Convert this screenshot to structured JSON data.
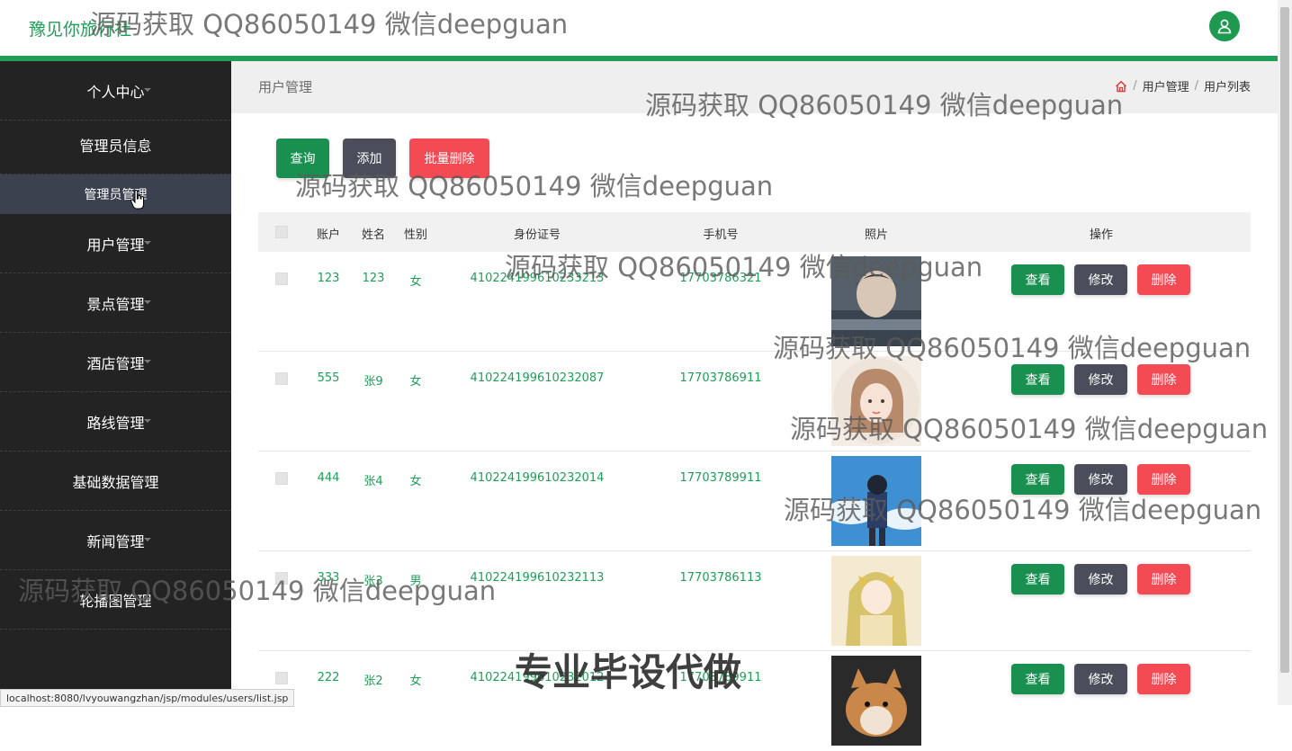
{
  "header": {
    "brand": "豫见你旅行社",
    "avatar_icon": "user-icon"
  },
  "sidebar": {
    "items": [
      {
        "label": "个人中心"
      },
      {
        "label": "管理员信息"
      },
      {
        "label": "用户管理"
      },
      {
        "label": "景点管理"
      },
      {
        "label": "酒店管理"
      },
      {
        "label": "路线管理"
      },
      {
        "label": "基础数据管理"
      },
      {
        "label": "新闻管理"
      },
      {
        "label": "轮播图管理"
      }
    ],
    "active_sub": "管理员管理"
  },
  "breadcrumb": {
    "title": "用户管理",
    "path": [
      "用户管理",
      "用户列表"
    ],
    "home_icon": "home-icon"
  },
  "toolbar": {
    "query": "查询",
    "add": "添加",
    "bulk_delete": "批量删除"
  },
  "table": {
    "headers": [
      "账户",
      "姓名",
      "性别",
      "身份证号",
      "手机号",
      "照片",
      "操作"
    ],
    "rows": [
      {
        "account": "123",
        "name": "123",
        "gender": "女",
        "id_card": "410224199610233213",
        "phone": "17703786321",
        "photo": "boy"
      },
      {
        "account": "555",
        "name": "张9",
        "gender": "女",
        "id_card": "410224199610232087",
        "phone": "17703786911",
        "photo": "girl"
      },
      {
        "account": "444",
        "name": "张4",
        "gender": "女",
        "id_card": "410224199610232014",
        "phone": "17703789911",
        "photo": "sky"
      },
      {
        "account": "333",
        "name": "张3",
        "gender": "男",
        "id_card": "410224199610232113",
        "phone": "17703786113",
        "photo": "anime"
      },
      {
        "account": "222",
        "name": "张2",
        "gender": "女",
        "id_card": "410224199610232012",
        "phone": "17703789911",
        "photo": "dog"
      }
    ],
    "actions": {
      "view": "查看",
      "edit": "修改",
      "delete": "删除"
    }
  },
  "watermark": {
    "text": "源码获取 QQ86050149 微信deepguan",
    "big_text": "专业毕设代做"
  },
  "status_url": "localhost:8080/lvyouwangzhan/jsp/modules/users/list.jsp",
  "colors": {
    "primary": "#1e9e57",
    "dark": "#4b4e5a",
    "danger": "#f34a54",
    "sidebar": "#232323"
  }
}
